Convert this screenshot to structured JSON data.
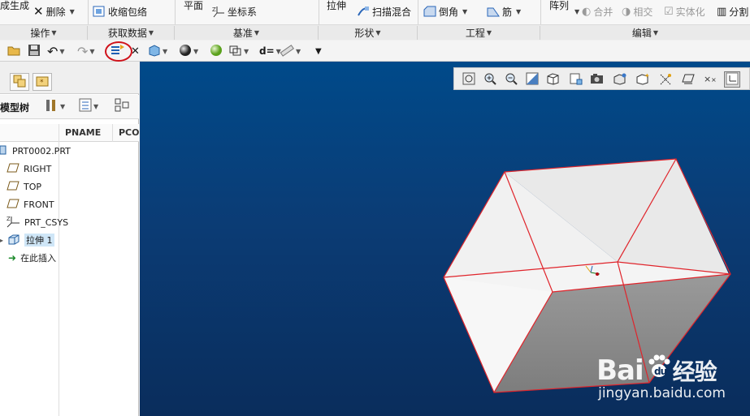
{
  "ribbon": {
    "items": {
      "generate": "成生成",
      "delete": "删除",
      "shrinkwrap": "收缩包络",
      "plane": "平面",
      "csys": "坐标系",
      "extrude": "拉伸",
      "sweep_blend": "扫描混合",
      "chamfer": "倒角",
      "rib": "筋",
      "pattern": "阵列",
      "merge": "合并",
      "intersect": "相交",
      "solidify": "实体化",
      "split": "分割"
    },
    "groups": {
      "operations": "操作",
      "get_data": "获取数据",
      "datum": "基准",
      "shapes": "形状",
      "engineering": "工程",
      "editing": "编辑"
    }
  },
  "left_panel": {
    "tree_title": "模型树",
    "columns": [
      "PNAME",
      "PCO"
    ],
    "tree": [
      {
        "label": "PRT0002.PRT",
        "icon": "part-icon"
      },
      {
        "label": "RIGHT",
        "icon": "datum-plane-icon"
      },
      {
        "label": "TOP",
        "icon": "datum-plane-icon"
      },
      {
        "label": "FRONT",
        "icon": "datum-plane-icon"
      },
      {
        "label": "PRT_CSYS",
        "icon": "csys-icon"
      },
      {
        "label": "拉伸 1",
        "icon": "extrude-feature-icon",
        "selected": true
      },
      {
        "label": "在此插入",
        "icon": "insert-here-arrow-icon"
      }
    ]
  },
  "watermark": {
    "brand": "Bai",
    "brand2": "du",
    "cn": "经验",
    "url": "jingyan.baidu.com"
  },
  "colors": {
    "highlight_ring": "#d0121b",
    "bg_top": "#004a8a",
    "bg_bottom": "#0a2d5c",
    "edge": "#e0242b",
    "selected_row": "#cfe6f7"
  }
}
